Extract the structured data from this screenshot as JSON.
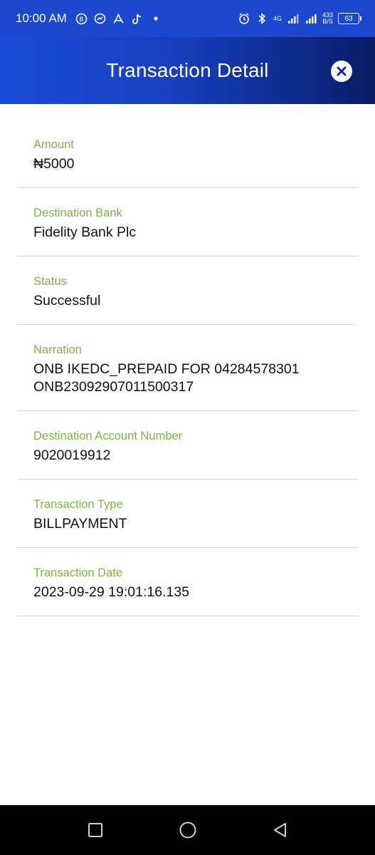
{
  "status_bar": {
    "time": "10:00 AM",
    "network": "4G",
    "speed_top": "433",
    "speed_bottom": "B/S",
    "battery": "63",
    "icons": [
      "b-circle-icon",
      "messenger-icon",
      "acrobat-icon",
      "tiktok-icon",
      "dot-icon",
      "alarm-icon",
      "bluetooth-icon",
      "signal-icon",
      "signal-icon-2"
    ]
  },
  "header": {
    "title": "Transaction Detail",
    "close_icon": "close-icon"
  },
  "fields": [
    {
      "label": "Amount",
      "value": "₦5000"
    },
    {
      "label": "Destination Bank",
      "value": "Fidelity Bank Plc"
    },
    {
      "label": "Status",
      "value": "Successful"
    },
    {
      "label": "Narration",
      "value": "ONB IKEDC_PREPAID FOR 04284578301\nONB23092907011500317"
    },
    {
      "label": "Destination Account Number",
      "value": "9020019912"
    },
    {
      "label": "Transaction Type",
      "value": "BILLPAYMENT"
    },
    {
      "label": "Transaction Date",
      "value": "2023-09-29 19:01:16.135"
    }
  ],
  "nav_bar": {
    "icons": [
      "recent-apps-icon",
      "home-icon",
      "back-icon"
    ]
  },
  "colors": {
    "header": "#1a4bd8",
    "label": "#7bb446",
    "divider": "#d4d4d4"
  }
}
